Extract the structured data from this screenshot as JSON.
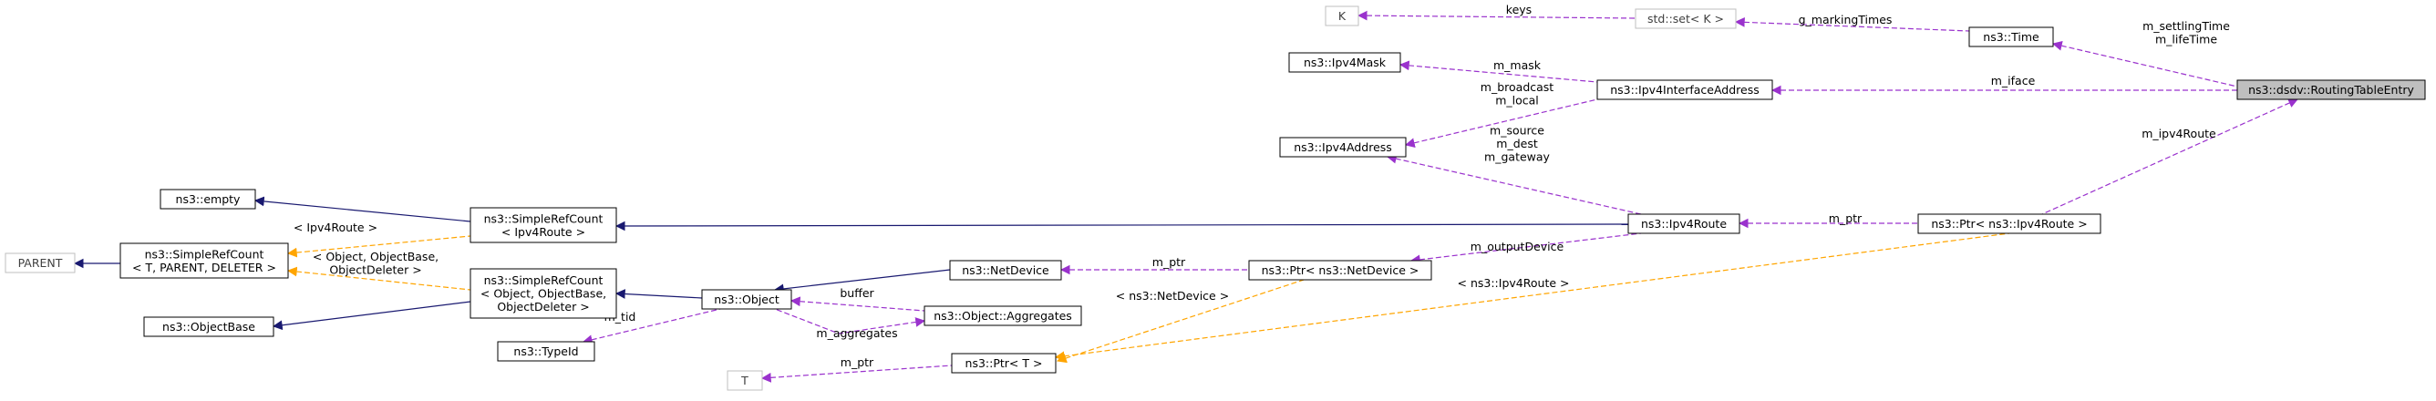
{
  "nodes": [
    {
      "id": "routing_table_entry",
      "lines": [
        "ns3::dsdv::RoutingTableEntry"
      ],
      "style": "focus"
    },
    {
      "id": "time",
      "lines": [
        "ns3::Time"
      ],
      "style": "normal"
    },
    {
      "id": "set_k",
      "lines": [
        "std::set< K >"
      ],
      "style": "ghost"
    },
    {
      "id": "k",
      "lines": [
        "K"
      ],
      "style": "ghost"
    },
    {
      "id": "ipv4_interface_address",
      "lines": [
        "ns3::Ipv4InterfaceAddress"
      ],
      "style": "normal"
    },
    {
      "id": "ipv4_mask",
      "lines": [
        "ns3::Ipv4Mask"
      ],
      "style": "normal"
    },
    {
      "id": "ipv4_address",
      "lines": [
        "ns3::Ipv4Address"
      ],
      "style": "normal"
    },
    {
      "id": "ipv4_route",
      "lines": [
        "ns3::Ipv4Route"
      ],
      "style": "normal"
    },
    {
      "id": "ptr_ipv4_route",
      "lines": [
        "ns3::Ptr< ns3::Ipv4Route >"
      ],
      "style": "normal"
    },
    {
      "id": "simple_ref_count_ipv4_route",
      "lines": [
        "ns3::SimpleRefCount",
        "< Ipv4Route >"
      ],
      "style": "normal"
    },
    {
      "id": "empty",
      "lines": [
        "ns3::empty"
      ],
      "style": "normal"
    },
    {
      "id": "simple_ref_count_template",
      "lines": [
        "ns3::SimpleRefCount",
        "< T, PARENT, DELETER >"
      ],
      "style": "normal"
    },
    {
      "id": "parent",
      "lines": [
        "PARENT"
      ],
      "style": "ghost"
    },
    {
      "id": "object_base",
      "lines": [
        "ns3::ObjectBase"
      ],
      "style": "normal"
    },
    {
      "id": "simple_ref_count_object",
      "lines": [
        "ns3::SimpleRefCount",
        "< Object, ObjectBase,",
        "ObjectDeleter >"
      ],
      "style": "normal"
    },
    {
      "id": "object",
      "lines": [
        "ns3::Object"
      ],
      "style": "normal"
    },
    {
      "id": "net_device",
      "lines": [
        "ns3::NetDevice"
      ],
      "style": "normal"
    },
    {
      "id": "ptr_net_device",
      "lines": [
        "ns3::Ptr< ns3::NetDevice >"
      ],
      "style": "normal"
    },
    {
      "id": "object_aggregates",
      "lines": [
        "ns3::Object::Aggregates"
      ],
      "style": "normal"
    },
    {
      "id": "type_id",
      "lines": [
        "ns3::TypeId"
      ],
      "style": "normal"
    },
    {
      "id": "ptr_t",
      "lines": [
        "ns3::Ptr< T >"
      ],
      "style": "normal"
    },
    {
      "id": "t",
      "lines": [
        "T"
      ],
      "style": "ghost"
    }
  ],
  "edges": [
    {
      "from": "time",
      "to": "routing_table_entry",
      "kind": "usage",
      "label": [
        "m_settlingTime",
        "m_lifeTime"
      ]
    },
    {
      "from": "ipv4_interface_address",
      "to": "routing_table_entry",
      "kind": "usage",
      "label": [
        "m_iface"
      ]
    },
    {
      "from": "ptr_ipv4_route",
      "to": "routing_table_entry",
      "kind": "usage",
      "label": [
        "m_ipv4Route"
      ]
    },
    {
      "from": "set_k",
      "to": "time",
      "kind": "usage",
      "label": [
        "g_markingTimes"
      ]
    },
    {
      "from": "k",
      "to": "set_k",
      "kind": "usage",
      "label": [
        "keys"
      ]
    },
    {
      "from": "ipv4_mask",
      "to": "ipv4_interface_address",
      "kind": "usage",
      "label": [
        "m_mask"
      ]
    },
    {
      "from": "ipv4_address",
      "to": "ipv4_interface_address",
      "kind": "usage",
      "label": [
        "m_broadcast",
        "m_local"
      ]
    },
    {
      "from": "ipv4_address",
      "to": "ipv4_route",
      "kind": "usage",
      "label": [
        "m_source",
        "m_dest",
        "m_gateway"
      ]
    },
    {
      "from": "ipv4_route",
      "to": "ptr_ipv4_route",
      "kind": "usage",
      "label": [
        "m_ptr"
      ]
    },
    {
      "from": "ptr_net_device",
      "to": "ipv4_route",
      "kind": "usage",
      "label": [
        "m_outputDevice"
      ]
    },
    {
      "from": "simple_ref_count_ipv4_route",
      "to": "ipv4_route",
      "kind": "inherit",
      "label": []
    },
    {
      "from": "empty",
      "to": "simple_ref_count_ipv4_route",
      "kind": "inherit",
      "label": []
    },
    {
      "from": "simple_ref_count_template",
      "to": "simple_ref_count_ipv4_route",
      "kind": "template",
      "label": [
        "< Ipv4Route >"
      ]
    },
    {
      "from": "simple_ref_count_template",
      "to": "simple_ref_count_object",
      "kind": "template",
      "label": [
        "< Object, ObjectBase,",
        "ObjectDeleter >"
      ]
    },
    {
      "from": "parent",
      "to": "simple_ref_count_template",
      "kind": "inherit",
      "label": []
    },
    {
      "from": "object_base",
      "to": "simple_ref_count_object",
      "kind": "inherit",
      "label": []
    },
    {
      "from": "simple_ref_count_object",
      "to": "object",
      "kind": "inherit",
      "label": []
    },
    {
      "from": "object",
      "to": "net_device",
      "kind": "inherit",
      "label": []
    },
    {
      "from": "net_device",
      "to": "ptr_net_device",
      "kind": "usage",
      "label": [
        "m_ptr"
      ]
    },
    {
      "from": "object",
      "to": "object_aggregates",
      "kind": "usage",
      "label": [
        "buffer"
      ]
    },
    {
      "from": "object_aggregates",
      "to": "object",
      "kind": "usage",
      "label": [
        "m_aggregates"
      ]
    },
    {
      "from": "type_id",
      "to": "object",
      "kind": "usage",
      "label": [
        "m_tid"
      ]
    },
    {
      "from": "ptr_t",
      "to": "ptr_net_device",
      "kind": "template",
      "label": [
        "< ns3::NetDevice >"
      ]
    },
    {
      "from": "ptr_t",
      "to": "ptr_ipv4_route",
      "kind": "template",
      "label": [
        "< ns3::Ipv4Route >"
      ]
    },
    {
      "from": "t",
      "to": "ptr_t",
      "kind": "usage",
      "label": [
        "m_ptr"
      ]
    }
  ],
  "colors": {
    "usage": "#9a32cd",
    "inherit": "#191970",
    "template": "#ffa500",
    "focus_fill": "#bfbfbf",
    "ghost_stroke": "#bfbfbf"
  }
}
